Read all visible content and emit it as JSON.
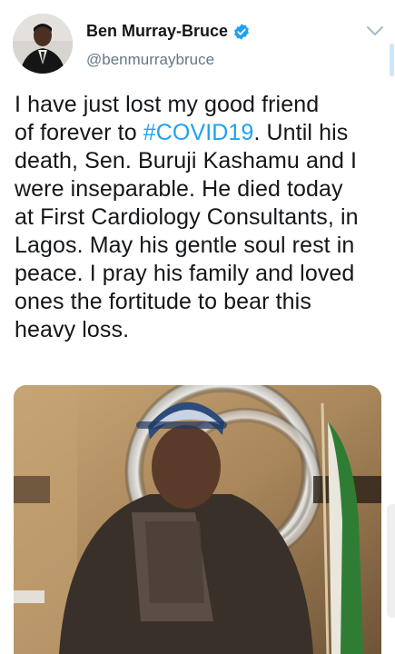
{
  "tweet": {
    "display_name": "Ben Murray-Bruce",
    "handle": "@benmurraybruce",
    "text_before_hashtag": "I have just lost my good friend\nof forever to ",
    "hashtag": "#COVID19",
    "text_after_hashtag": ". Until his\ndeath, Sen. Buruji Kashamu and I\nwere inseparable. He died today\nat First Cardiology Consultants, in\nLagos. May his gentle soul rest in\npeace. I pray his family and loved\nones the fortitude to bear this\nheavy loss.",
    "verified": true
  },
  "icons": {
    "verified": "verified-badge-icon",
    "menu": "chevron-down-icon"
  },
  "colors": {
    "link": "#1da1f2",
    "text": "#14171a",
    "secondary": "#657786"
  }
}
